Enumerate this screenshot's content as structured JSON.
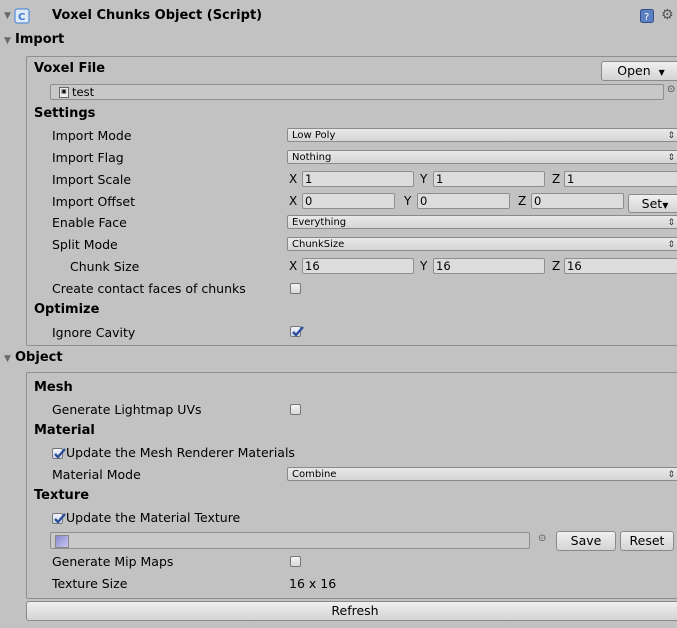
{
  "header": {
    "title": "Voxel Chunks Object (Script)"
  },
  "import_foldout": {
    "label": "Import"
  },
  "voxel_file": {
    "label": "Voxel File",
    "open_label": "Open",
    "file_value": "test"
  },
  "settings": {
    "label": "Settings",
    "import_mode": {
      "label": "Import Mode",
      "value": "Low Poly"
    },
    "import_flag": {
      "label": "Import Flag",
      "value": "Nothing"
    },
    "import_scale": {
      "label": "Import Scale",
      "x": "1",
      "y": "1",
      "z": "1"
    },
    "import_offset": {
      "label": "Import Offset",
      "x": "0",
      "y": "0",
      "z": "0",
      "set_label": "Set"
    },
    "enable_face": {
      "label": "Enable Face",
      "value": "Everything"
    },
    "split_mode": {
      "label": "Split Mode",
      "value": "ChunkSize"
    },
    "chunk_size": {
      "label": "Chunk Size",
      "x": "16",
      "y": "16",
      "z": "16"
    },
    "contact_faces": {
      "label": "Create contact faces of chunks",
      "checked": false
    }
  },
  "axes": {
    "x": "X",
    "y": "Y",
    "z": "Z"
  },
  "optimize": {
    "label": "Optimize",
    "ignore_cavity": {
      "label": "Ignore Cavity",
      "checked": true
    }
  },
  "object_foldout": {
    "label": "Object"
  },
  "mesh": {
    "label": "Mesh",
    "lightmap_uvs": {
      "label": "Generate Lightmap UVs",
      "checked": false
    }
  },
  "material": {
    "label": "Material",
    "update_renderer": {
      "label": "Update the Mesh Renderer Materials",
      "checked": true
    },
    "mode": {
      "label": "Material Mode",
      "value": "Combine"
    }
  },
  "texture": {
    "label": "Texture",
    "update_texture": {
      "label": "Update the Material Texture",
      "checked": true
    },
    "save_label": "Save",
    "reset_label": "Reset",
    "mip_maps": {
      "label": "Generate Mip Maps",
      "checked": false
    },
    "size": {
      "label": "Texture Size",
      "value": "16 x 16"
    }
  },
  "refresh_label": "Refresh",
  "colors": {
    "background": "#c2c2c2",
    "checkbox_accent": "#2c4f9a",
    "script_icon": "#3b7fd1"
  }
}
